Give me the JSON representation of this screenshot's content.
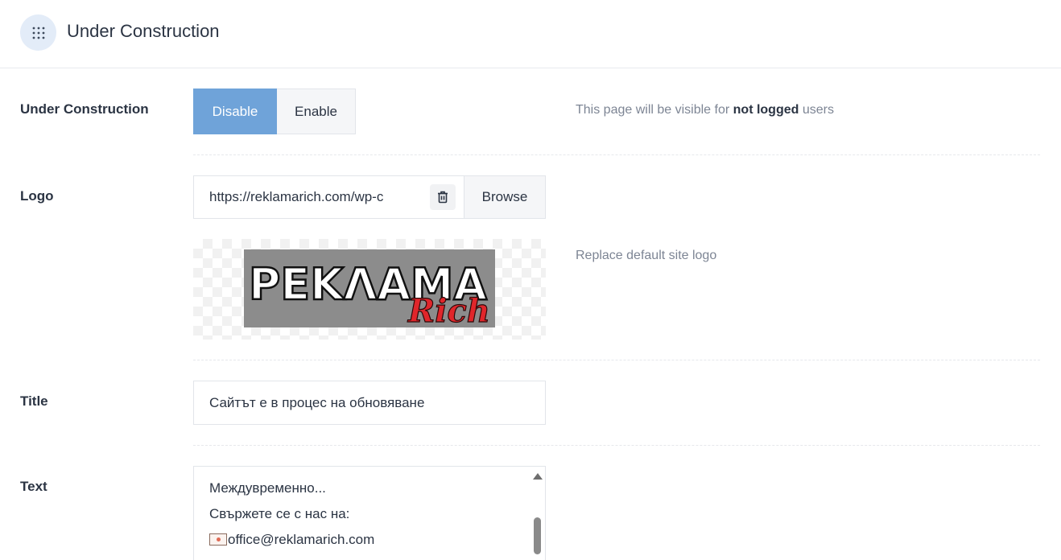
{
  "header": {
    "title": "Under Construction",
    "icon": "grid-dots-icon"
  },
  "under_construction": {
    "label": "Under Construction",
    "options": [
      "Disable",
      "Enable"
    ],
    "selected": "Disable",
    "help_prefix": "This page will be visible for ",
    "help_bold": "not logged",
    "help_suffix": " users"
  },
  "logo": {
    "label": "Logo",
    "url_value": "https://reklamarich.com/wp-c",
    "browse_label": "Browse",
    "help": "Replace default site logo",
    "image_text_main": "PEKΛAMA",
    "image_text_script": "Rich"
  },
  "title_field": {
    "label": "Title",
    "value": "Сайтът е в процес на обновяване"
  },
  "text_field": {
    "label": "Text",
    "lines": [
      "Междувременно...",
      "Свържете се с нас на:",
      "office@reklamarich.com"
    ]
  },
  "colors": {
    "accent": "#6fa3d9",
    "text": "#2b3443",
    "muted": "#7d8594",
    "logo_red": "#e0262b"
  }
}
